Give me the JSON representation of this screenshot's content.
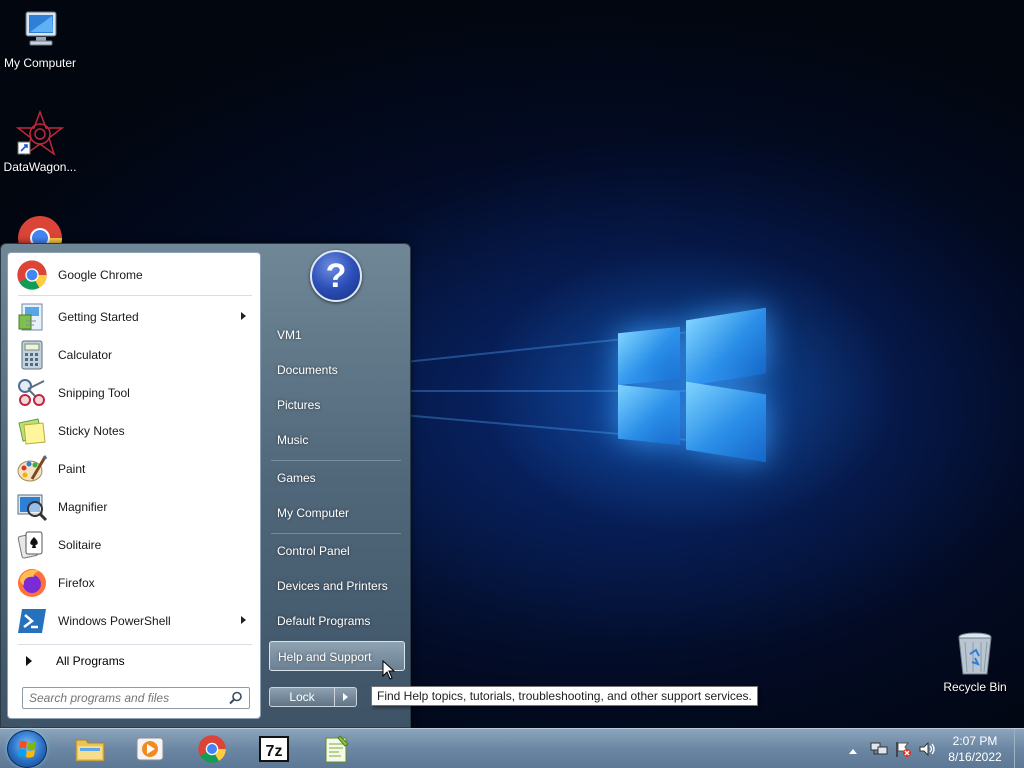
{
  "desktop": {
    "icons": [
      {
        "label": "My Computer",
        "icon": "computer-icon"
      },
      {
        "label": "DataWagon...",
        "icon": "datawagon-icon"
      },
      {
        "label": "Recycle Bin",
        "icon": "recycle-bin-icon"
      }
    ]
  },
  "start_menu": {
    "pinned": [
      {
        "label": "Google Chrome",
        "icon": "chrome-icon",
        "submenu": false
      },
      {
        "label": "Getting Started",
        "icon": "getting-started-icon",
        "submenu": true
      },
      {
        "label": "Calculator",
        "icon": "calculator-icon",
        "submenu": false
      },
      {
        "label": "Snipping Tool",
        "icon": "scissors-icon",
        "submenu": false
      },
      {
        "label": "Sticky Notes",
        "icon": "sticky-notes-icon",
        "submenu": false
      },
      {
        "label": "Paint",
        "icon": "paint-icon",
        "submenu": false
      },
      {
        "label": "Magnifier",
        "icon": "magnifier-icon",
        "submenu": false
      },
      {
        "label": "Solitaire",
        "icon": "solitaire-icon",
        "submenu": false
      },
      {
        "label": "Firefox",
        "icon": "firefox-icon",
        "submenu": false
      },
      {
        "label": "Windows PowerShell",
        "icon": "powershell-icon",
        "submenu": true
      }
    ],
    "all_programs": "All Programs",
    "search_placeholder": "Search programs and files",
    "right_items": [
      {
        "label": "VM1"
      },
      {
        "label": "Documents"
      },
      {
        "label": "Pictures"
      },
      {
        "label": "Music"
      },
      {
        "label": "Games"
      },
      {
        "label": "My Computer"
      },
      {
        "label": "Control Panel"
      },
      {
        "label": "Devices and Printers"
      },
      {
        "label": "Default Programs"
      },
      {
        "label": "Help and Support",
        "highlighted": true
      }
    ],
    "lock_label": "Lock",
    "help_glyph": "?"
  },
  "tooltip": "Find Help topics, tutorials, troubleshooting, and other support services.",
  "taskbar": {
    "apps": [
      {
        "icon": "file-explorer-icon"
      },
      {
        "icon": "media-player-icon"
      },
      {
        "icon": "chrome-icon"
      },
      {
        "icon": "seven-zip-icon",
        "text": "7z"
      },
      {
        "icon": "notepad-plus-icon"
      }
    ],
    "clock": {
      "time": "2:07 PM",
      "date": "8/16/2022"
    }
  },
  "colors": {
    "accent": "#2a6fc4",
    "taskbar": "#6c87a3",
    "menu": "#50677a"
  }
}
